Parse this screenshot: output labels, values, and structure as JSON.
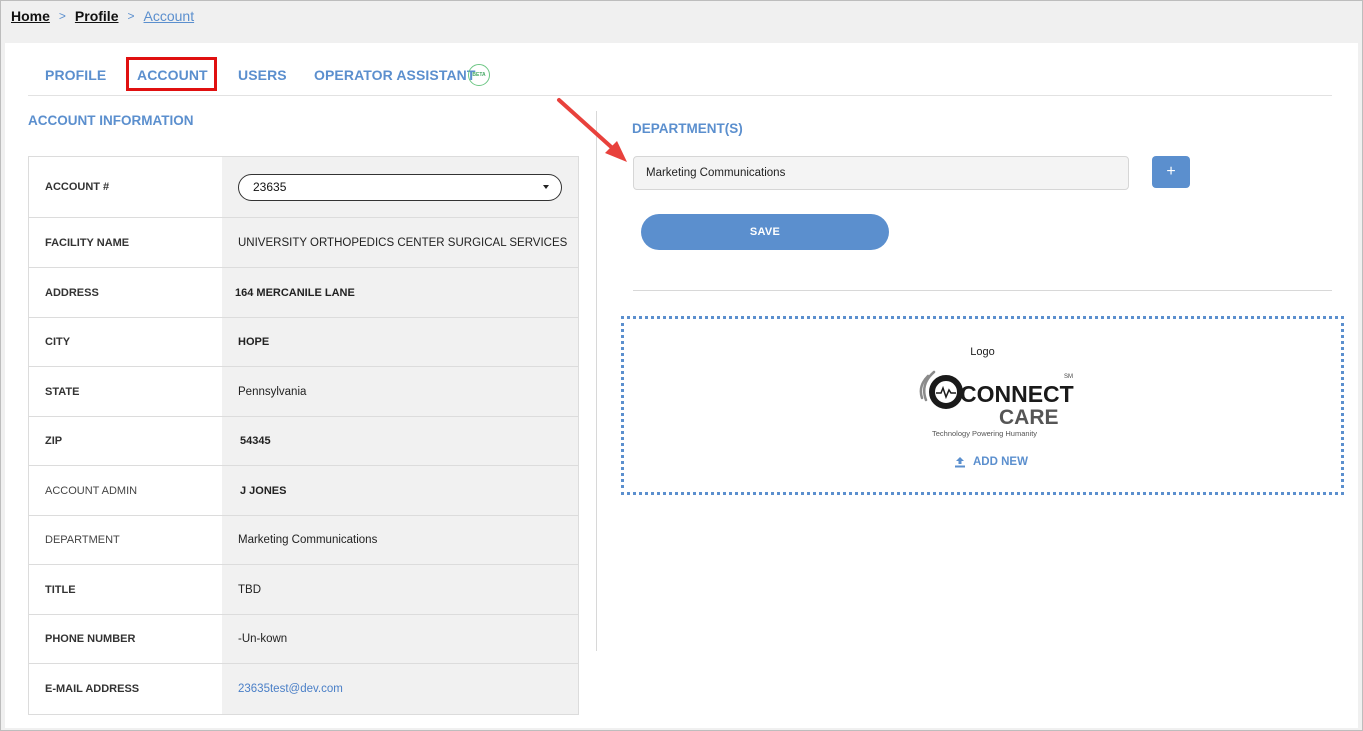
{
  "breadcrumb": {
    "home": "Home",
    "profile": "Profile",
    "current": "Account",
    "separator": ">"
  },
  "tabs": {
    "profile": "PROFILE",
    "account": "ACCOUNT",
    "users": "USERS",
    "operator": "OPERATOR ASSISTANT",
    "beta": "BETA"
  },
  "account_info": {
    "title": "ACCOUNT INFORMATION",
    "rows": [
      {
        "label": "ACCOUNT #",
        "value": "23635"
      },
      {
        "label": "FACILITY NAME",
        "value": "UNIVERSITY ORTHOPEDICS CENTER SURGICAL SERVICES"
      },
      {
        "label": "ADDRESS",
        "value": "164 MERCANILE LANE"
      },
      {
        "label": "CITY",
        "value": "HOPE"
      },
      {
        "label": "STATE",
        "value": "Pennsylvania"
      },
      {
        "label": "ZIP",
        "value": "54345"
      },
      {
        "label": "ACCOUNT ADMIN",
        "value": "J JONES"
      },
      {
        "label": "DEPARTMENT",
        "value": "Marketing Communications"
      },
      {
        "label": "TITLE",
        "value": "TBD"
      },
      {
        "label": "PHONE NUMBER",
        "value": "-Un-kown"
      },
      {
        "label": "E-MAIL ADDRESS",
        "value": "23635test@dev.com"
      }
    ]
  },
  "department": {
    "title": "DEPARTMENT(S)",
    "input_value": "Marketing Communications",
    "add_label": "+",
    "save_label": "SAVE"
  },
  "logo": {
    "label": "Logo",
    "brand_line1": "CONNECT",
    "brand_line2": "CARE",
    "brand_mark": "SM",
    "tagline": "Technology Powering Humanity",
    "add_new": "ADD NEW"
  },
  "colors": {
    "accent": "#5b8fce",
    "highlight_box": "#e01010",
    "annotation_arrow": "#e8413c"
  }
}
